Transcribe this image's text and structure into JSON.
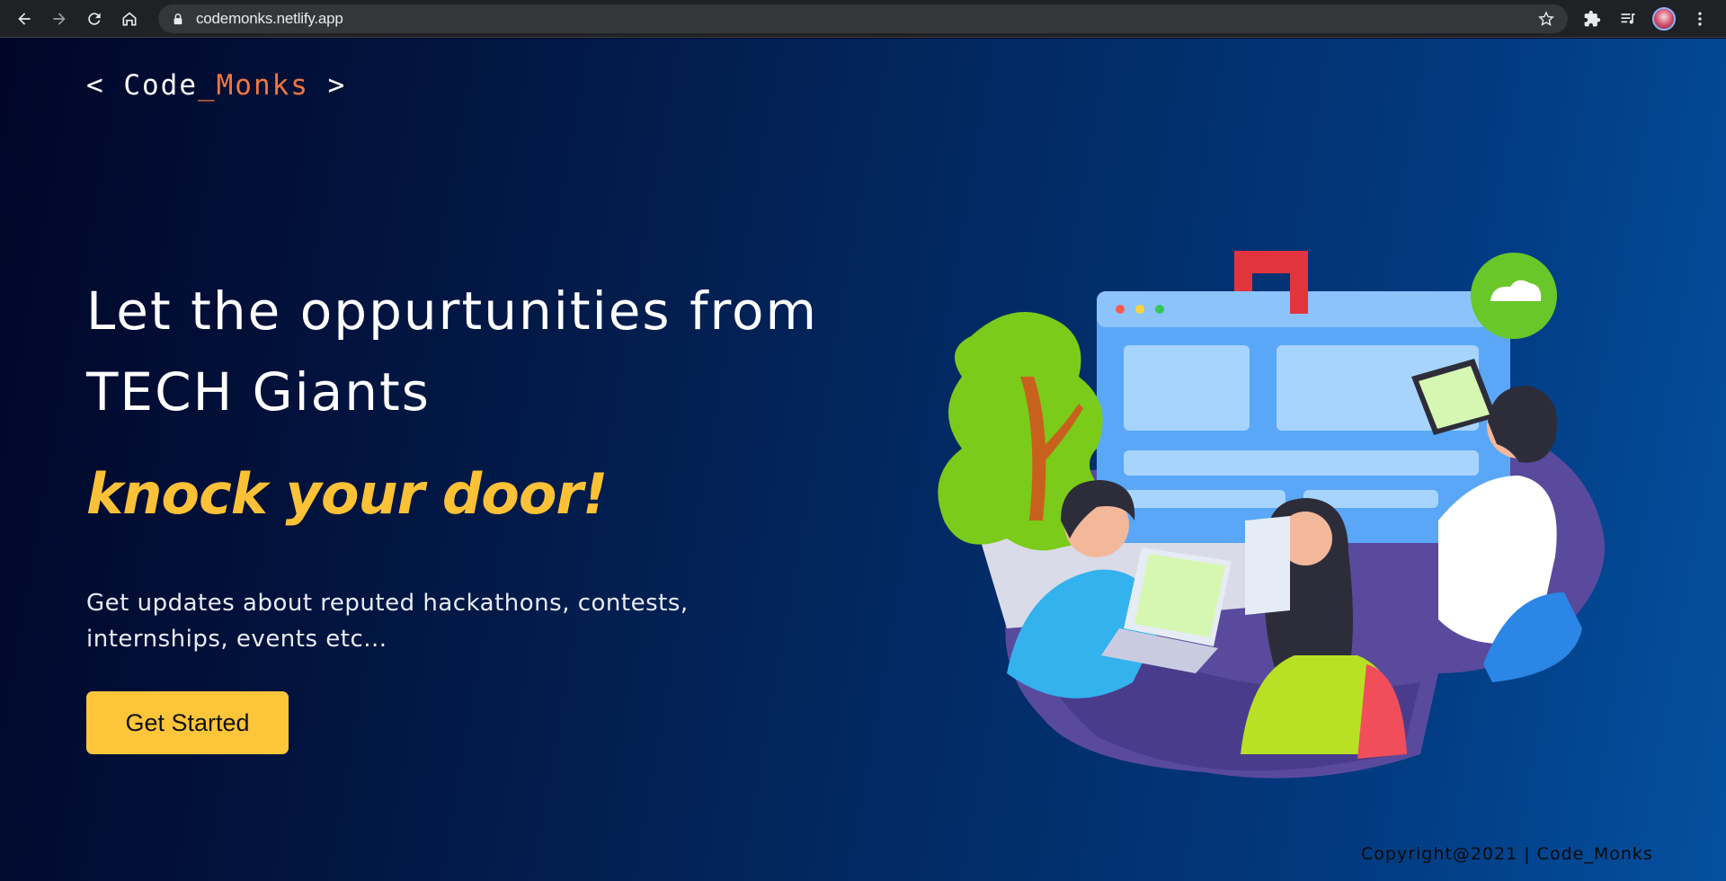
{
  "browser": {
    "url": "codemonks.netlify.app",
    "icons": [
      "back-icon",
      "forward-icon",
      "reload-icon",
      "home-icon",
      "lock-icon",
      "star-icon",
      "puzzle-icon",
      "media-icon",
      "avatar",
      "menu-icon"
    ]
  },
  "header": {
    "logo_prefix": "< Code",
    "logo_accent": "_Monks",
    "logo_suffix": " >"
  },
  "hero": {
    "headline": "Let the oppurtunities from TECH Giants",
    "tagline": "knock your door!",
    "description": "Get updates about reputed hackathons, contests, internships, events etc...",
    "cta_label": "Get Started"
  },
  "footer": {
    "copyright": "Copyright@2021 | Code_Monks"
  },
  "colors": {
    "accent_orange": "#f0773f",
    "tagline_yellow": "#fcc136",
    "button_yellow": "#fdc53a",
    "bg_dark": "#010628",
    "bg_blue": "#04509f"
  }
}
